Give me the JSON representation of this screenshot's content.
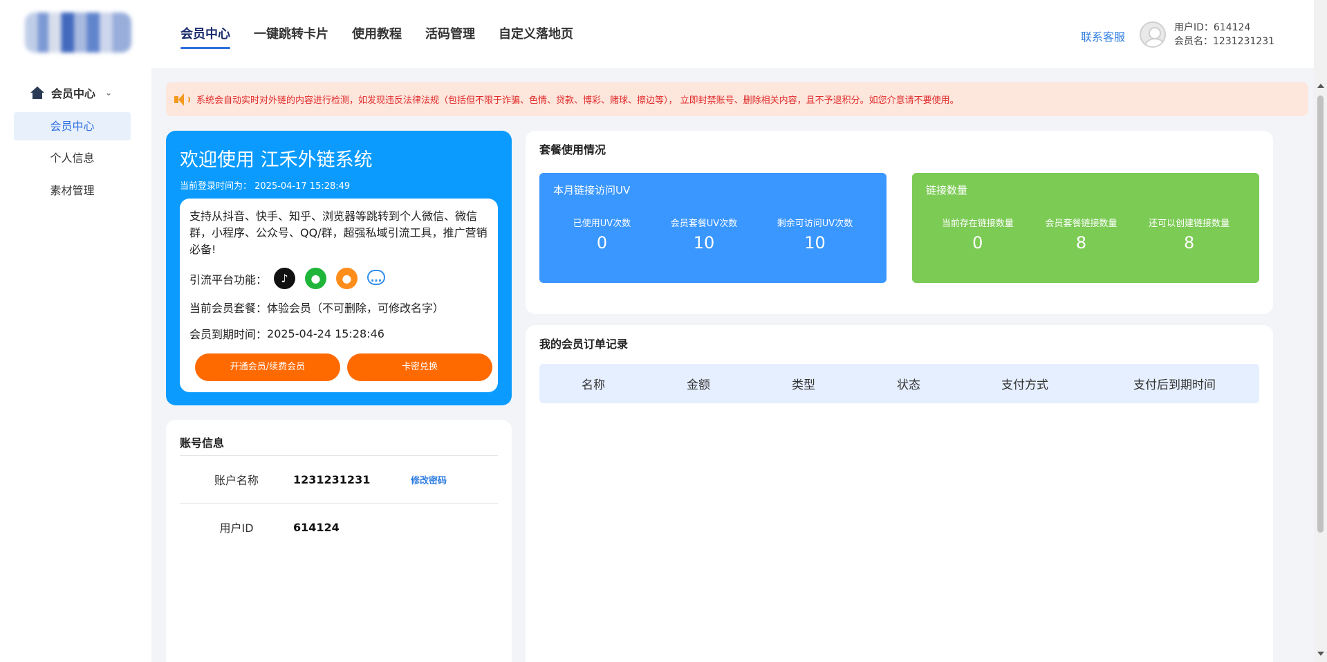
{
  "header": {
    "nav": [
      "会员中心",
      "一键跳转卡片",
      "使用教程",
      "活码管理",
      "自定义落地页"
    ],
    "contact": "联系客服",
    "user_id_line": "用户ID：614124",
    "member_name_line": "会员名：1231231231"
  },
  "sidebar": {
    "title": "会员中心",
    "items": [
      "会员中心",
      "个人信息",
      "素材管理"
    ]
  },
  "notice": "系统会自动实时对外链的内容进行检测，如发现违反法律法规（包括但不限于诈骗、色情、贷款、博彩、赌球、擦边等）， 立即封禁账号、删除相关内容，且不予退积分。如您介意请不要使用。",
  "welcome": {
    "title": "欢迎使用 江禾外链系统",
    "login_time": "当前登录时间为：  2025-04-17 15:28:49",
    "desc": "支持从抖音、快手、知乎、浏览器等跳转到个人微信、微信群，小程序、公众号、QQ/群，超强私域引流工具，推广营销必备!",
    "platform_label": "引流平台功能：",
    "package_label": "当前会员套餐：",
    "package_value": "体验会员（不可删除，可修改名字）",
    "expire_label": "会员到期时间：",
    "expire_value": "2025-04-24 15:28:46",
    "btn_open": "开通会员/续费会员",
    "btn_card": "卡密兑换"
  },
  "account": {
    "title": "账号信息",
    "name_label": "账户名称",
    "name_value": "1231231231",
    "change_pwd": "修改密码",
    "id_label": "用户ID",
    "id_value": "614124"
  },
  "usage": {
    "title": "套餐使用情况",
    "uv_box": {
      "title": "本月链接访问UV",
      "stats": [
        {
          "label": "已使用UV次数",
          "value": "0"
        },
        {
          "label": "会员套餐UV次数",
          "value": "10"
        },
        {
          "label": "剩余可访问UV次数",
          "value": "10"
        }
      ]
    },
    "link_box": {
      "title": "链接数量",
      "stats": [
        {
          "label": "当前存在链接数量",
          "value": "0"
        },
        {
          "label": "会员套餐链接数量",
          "value": "8"
        },
        {
          "label": "还可以创建链接数量",
          "value": "8"
        }
      ]
    }
  },
  "orders": {
    "title": "我的会员订单记录",
    "columns": [
      "名称",
      "金额",
      "类型",
      "状态",
      "支付方式",
      "支付后到期时间"
    ]
  },
  "colors": {
    "accent": "#2f6fde",
    "welcome_bg": "#0b9bff",
    "orange": "#ff6a00",
    "uv_box": "#3a97ff",
    "link_box": "#7ccb55",
    "notice_text": "#e02a2a"
  }
}
